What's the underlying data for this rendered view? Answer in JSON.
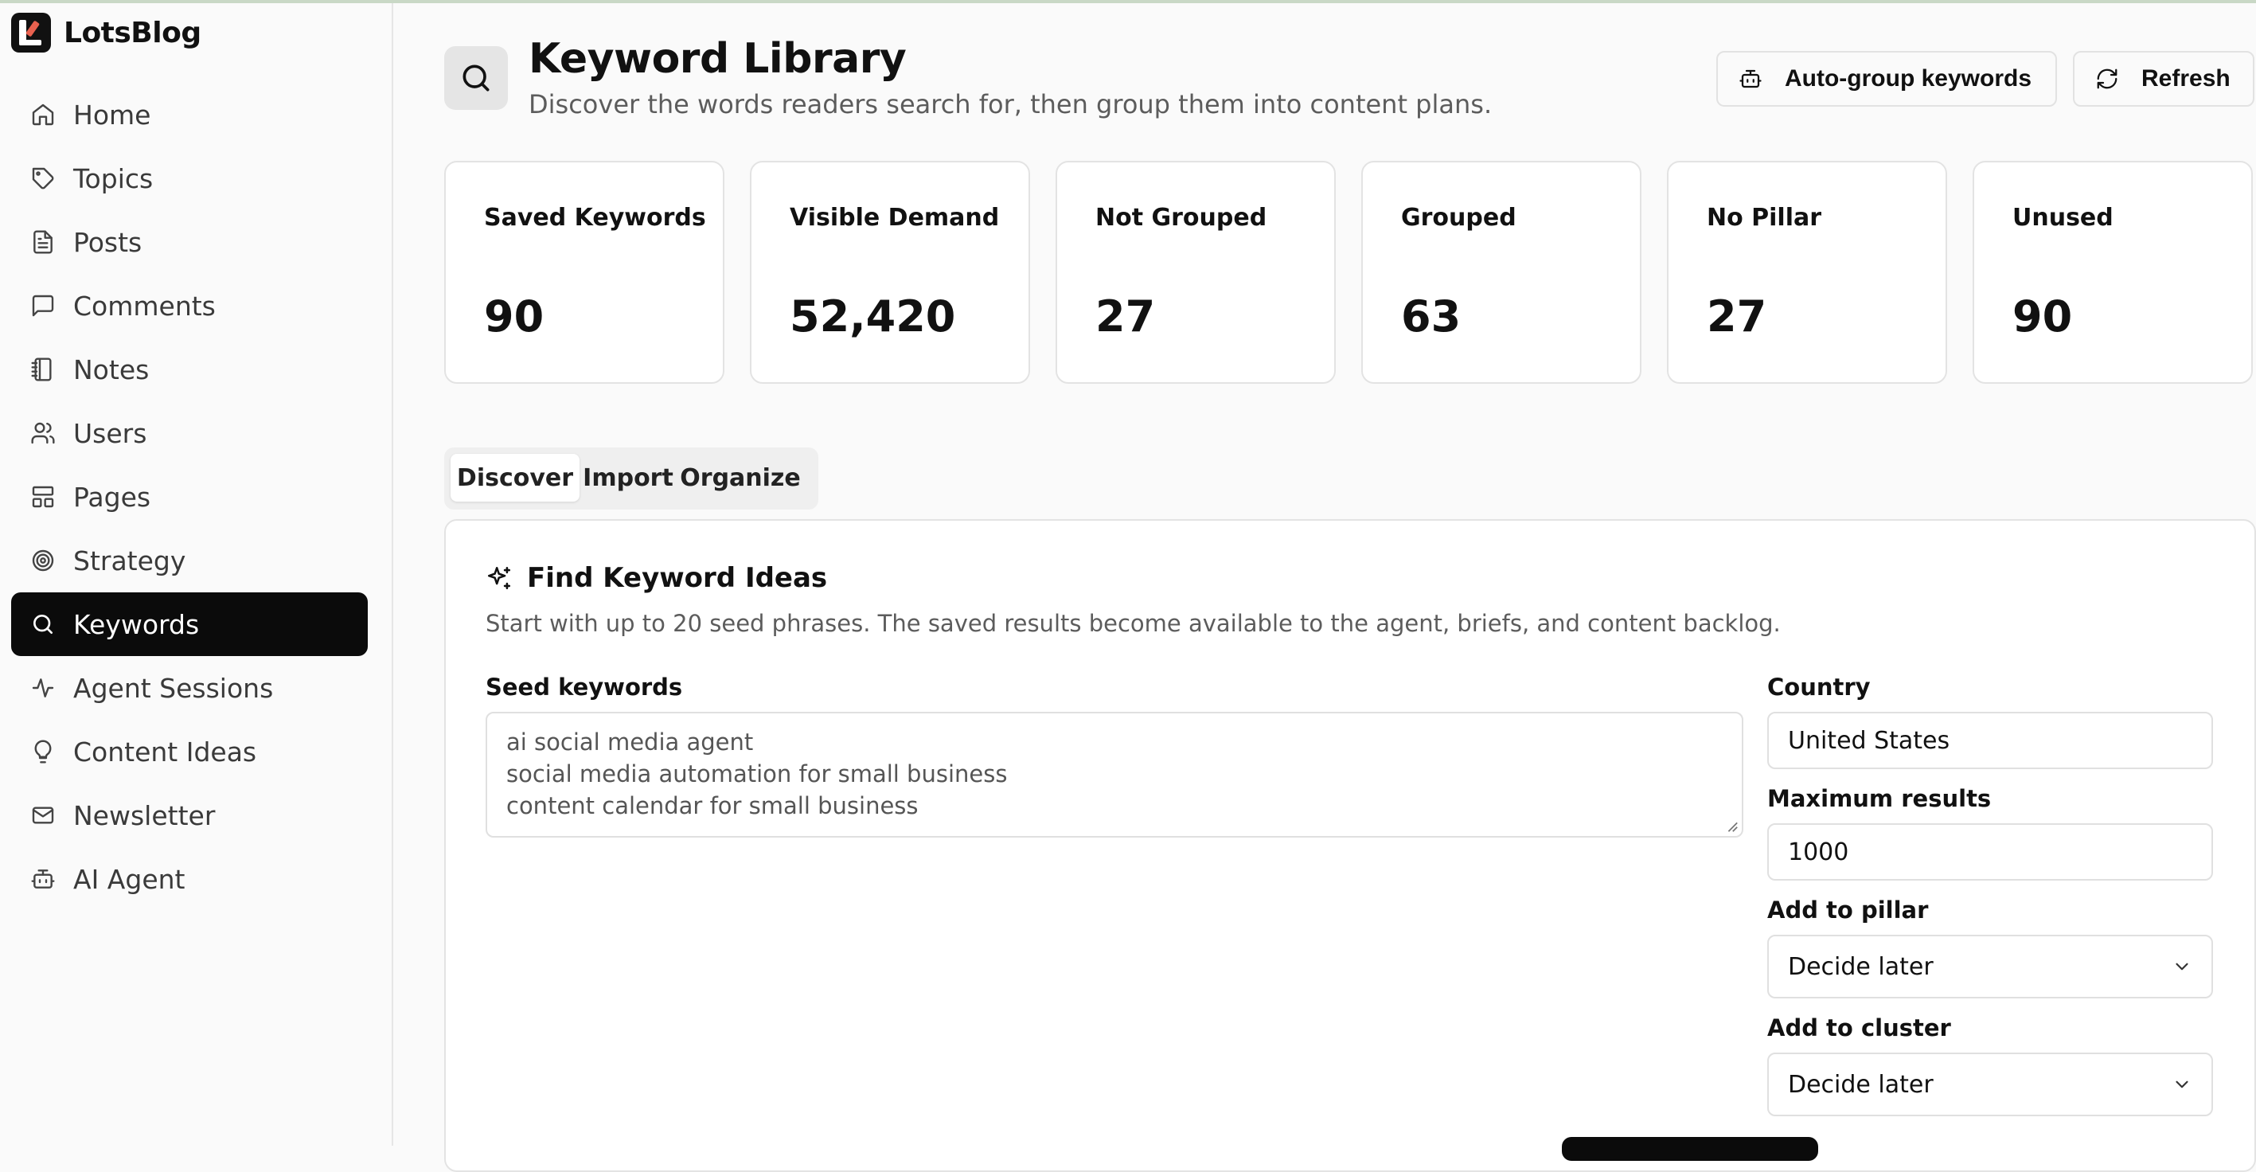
{
  "brand": {
    "name": "LotsBlog",
    "logo_icon": "lotsblog-logo"
  },
  "sidebar": {
    "items": [
      {
        "label": "Home",
        "icon": "home-icon",
        "active": false
      },
      {
        "label": "Topics",
        "icon": "tag-icon",
        "active": false
      },
      {
        "label": "Posts",
        "icon": "file-text-icon",
        "active": false
      },
      {
        "label": "Comments",
        "icon": "message-square-icon",
        "active": false
      },
      {
        "label": "Notes",
        "icon": "notebook-icon",
        "active": false
      },
      {
        "label": "Users",
        "icon": "users-icon",
        "active": false
      },
      {
        "label": "Pages",
        "icon": "layout-icon",
        "active": false
      },
      {
        "label": "Strategy",
        "icon": "target-icon",
        "active": false
      },
      {
        "label": "Keywords",
        "icon": "search-icon",
        "active": true
      },
      {
        "label": "Agent Sessions",
        "icon": "activity-icon",
        "active": false
      },
      {
        "label": "Content Ideas",
        "icon": "lightbulb-icon",
        "active": false
      },
      {
        "label": "Newsletter",
        "icon": "mail-icon",
        "active": false
      },
      {
        "label": "AI Agent",
        "icon": "bot-icon",
        "active": false
      }
    ]
  },
  "header": {
    "title": "Keyword Library",
    "subtitle": "Discover the words readers search for, then group them into content plans.",
    "auto_group_label": "Auto-group keywords",
    "refresh_label": "Refresh"
  },
  "stats": [
    {
      "label": "Saved Keywords",
      "value": "90"
    },
    {
      "label": "Visible Demand",
      "value": "52,420"
    },
    {
      "label": "Not Grouped",
      "value": "27"
    },
    {
      "label": "Grouped",
      "value": "63"
    },
    {
      "label": "No Pillar",
      "value": "27"
    },
    {
      "label": "Unused",
      "value": "90"
    }
  ],
  "tabs": [
    {
      "label": "Discover",
      "active": true
    },
    {
      "label": "Import",
      "active": false
    },
    {
      "label": "Organize",
      "active": false
    }
  ],
  "discover": {
    "title": "Find Keyword Ideas",
    "description": "Start with up to 20 seed phrases. The saved results become available to the agent, briefs, and content backlog.",
    "seed_label": "Seed keywords",
    "seed_lines": [
      "ai social media agent",
      "social media automation for small business",
      "content calendar for small business"
    ],
    "country_label": "Country",
    "country_value": "United States",
    "max_results_label": "Maximum results",
    "max_results_value": "1000",
    "pillar_label": "Add to pillar",
    "pillar_value": "Decide later",
    "cluster_label": "Add to cluster",
    "cluster_value": "Decide later"
  },
  "colors": {
    "active_nav_bg": "#0b0b0b",
    "logo_accent": "#e8614f",
    "page_bg": "#fafafa"
  }
}
